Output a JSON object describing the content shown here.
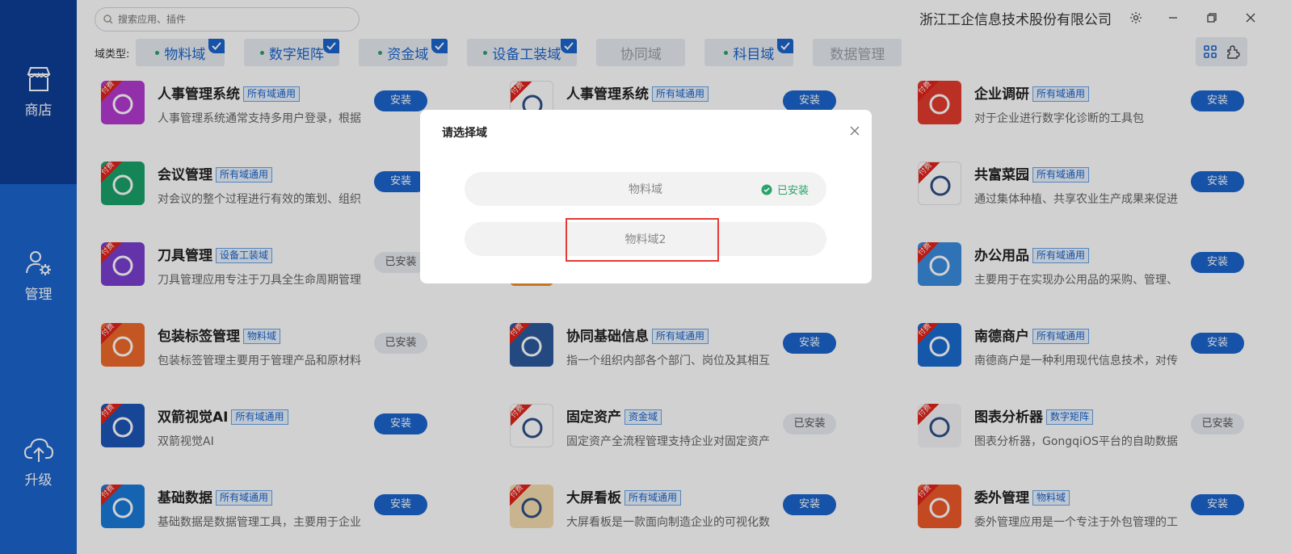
{
  "sidebar": {
    "items": [
      {
        "label": "商店",
        "icon": "store-icon"
      },
      {
        "label": "管理",
        "icon": "user-gear-icon"
      },
      {
        "label": "升级",
        "icon": "cloud-upload-icon"
      }
    ]
  },
  "header": {
    "search_placeholder": "搜索应用、插件",
    "company": "浙江工企信息技术股份有限公司"
  },
  "domains": {
    "label": "域类型:",
    "chips": [
      {
        "label": "物料域",
        "checked": true
      },
      {
        "label": "数字矩阵",
        "checked": true
      },
      {
        "label": "资金域",
        "checked": true
      },
      {
        "label": "设备工装域",
        "checked": true
      },
      {
        "label": "协同域",
        "checked": false
      },
      {
        "label": "科目域",
        "checked": true
      },
      {
        "label": "数据管理",
        "checked": false
      }
    ]
  },
  "paid_badge": "付费",
  "apps": [
    {
      "name": "人事管理系统",
      "tag": "所有域通用",
      "desc": "人事管理系统通常支持多用户登录，根据",
      "btn": "安装",
      "state": "install",
      "color": "#b43ad0"
    },
    {
      "name": "人事管理系统",
      "tag": "所有域通用",
      "desc": "",
      "btn": "安装",
      "state": "install",
      "color": "#ffffff"
    },
    {
      "name": "企业调研",
      "tag": "所有域通用",
      "desc": "对于企业进行数字化诊断的工具包",
      "btn": "安装",
      "state": "install",
      "color": "#e33b2e"
    },
    {
      "name": "会议管理",
      "tag": "所有域通用",
      "desc": "对会议的整个过程进行有效的策划、组织",
      "btn": "安装",
      "state": "install",
      "color": "#1aa36b"
    },
    {
      "name": "",
      "tag": "",
      "desc": "",
      "btn": "",
      "state": "hidden",
      "color": "#ffffff"
    },
    {
      "name": "共富菜园",
      "tag": "所有域通用",
      "desc": "通过集体种植、共享农业生产成果来促进",
      "btn": "安装",
      "state": "install",
      "color": "#ffffff"
    },
    {
      "name": "刀具管理",
      "tag": "设备工装域",
      "desc": "刀具管理应用专注于刀具全生命周期管理",
      "btn": "已安装",
      "state": "installed",
      "color": "#7b3fd0"
    },
    {
      "name": "",
      "tag": "",
      "desc": "",
      "btn": "",
      "state": "hidden",
      "color": "#f0902a"
    },
    {
      "name": "办公用品",
      "tag": "所有域通用",
      "desc": "主要用于在实现办公用品的采购、管理、",
      "btn": "安装",
      "state": "install",
      "color": "#3b8bde"
    },
    {
      "name": "包装标签管理",
      "tag": "物料域",
      "desc": "包装标签管理主要用于管理产品和原材料",
      "btn": "已安装",
      "state": "installed",
      "color": "#ee6a2a"
    },
    {
      "name": "协同基础信息",
      "tag": "所有域通用",
      "desc": "指一个组织内部各个部门、岗位及其相互",
      "btn": "安装",
      "state": "install",
      "color": "#2d5a9e"
    },
    {
      "name": "南德商户",
      "tag": "所有域通用",
      "desc": "南德商户是一种利用现代信息技术，对传",
      "btn": "安装",
      "state": "install",
      "color": "#1a6cd0"
    },
    {
      "name": "双箭视觉AI",
      "tag": "所有域通用",
      "desc": "双箭视觉AI",
      "btn": "安装",
      "state": "install",
      "color": "#1e56b8"
    },
    {
      "name": "固定资产",
      "tag": "资金域",
      "desc": "固定资产全流程管理支持企业对固定资产",
      "btn": "已安装",
      "state": "installed",
      "color": "#ffffff"
    },
    {
      "name": "图表分析器",
      "tag": "数字矩阵",
      "desc": "图表分析器，GongqiOS平台的自助数据",
      "btn": "已安装",
      "state": "installed",
      "color": "#f4f5f8"
    },
    {
      "name": "基础数据",
      "tag": "所有域通用",
      "desc": "基础数据是数据管理工具，主要用于企业",
      "btn": "安装",
      "state": "install",
      "color": "#1a7ad8"
    },
    {
      "name": "大屏看板",
      "tag": "所有域通用",
      "desc": "大屏看板是一款面向制造企业的可视化数",
      "btn": "安装",
      "state": "install",
      "color": "#f4ddb0"
    },
    {
      "name": "委外管理",
      "tag": "物料域",
      "desc": "委外管理应用是一个专注于外包管理的工",
      "btn": "安装",
      "state": "install",
      "color": "#ee5a2a"
    }
  ],
  "modal": {
    "title": "请选择域",
    "options": [
      {
        "label": "物料域",
        "status": "已安装"
      },
      {
        "label": "物料域2",
        "status": ""
      }
    ]
  }
}
